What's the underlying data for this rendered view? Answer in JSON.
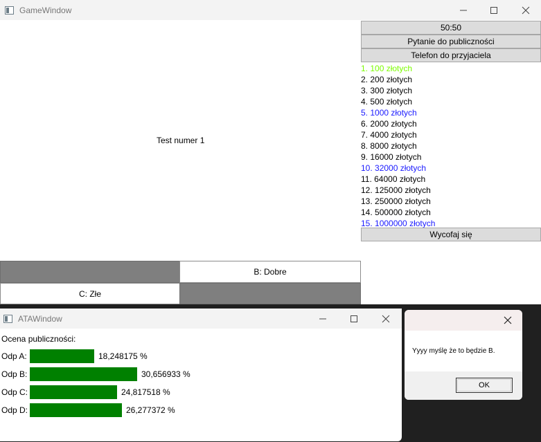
{
  "game_window": {
    "title": "GameWindow",
    "question": "Test numer 1",
    "lifelines": {
      "fifty": "50:50",
      "audience": "Pytanie do publiczności",
      "phone": "Telefon do przyjaciela"
    },
    "prizes": [
      {
        "label": "1. 100 złotych",
        "color": "#7cfc00"
      },
      {
        "label": "2. 200 złotych",
        "color": "#000000"
      },
      {
        "label": "3. 300 złotych",
        "color": "#000000"
      },
      {
        "label": "4. 500 złotych",
        "color": "#000000"
      },
      {
        "label": "5. 1000 złotych",
        "color": "#1a1aff"
      },
      {
        "label": "6. 2000 złotych",
        "color": "#000000"
      },
      {
        "label": "7. 4000 złotych",
        "color": "#000000"
      },
      {
        "label": "8. 8000 złotych",
        "color": "#000000"
      },
      {
        "label": "9. 16000 złotych",
        "color": "#000000"
      },
      {
        "label": "10. 32000 złotych",
        "color": "#1a1aff"
      },
      {
        "label": "11. 64000 złotych",
        "color": "#000000"
      },
      {
        "label": "12. 125000 złotych",
        "color": "#000000"
      },
      {
        "label": "13. 250000 złotych",
        "color": "#000000"
      },
      {
        "label": "14. 500000 złotych",
        "color": "#000000"
      },
      {
        "label": "15. 1000000 złotych",
        "color": "#1a1aff"
      }
    ],
    "withdraw": "Wycofaj się",
    "answers": {
      "a": "",
      "b": "B: Dobre",
      "c": "C: Złe",
      "d": ""
    }
  },
  "ata_window": {
    "title": "ATAWindow",
    "heading": "Ocena publiczności:",
    "rows": [
      {
        "label": "Odp A:",
        "percent_text": "18,248175 %",
        "value": 18.248175
      },
      {
        "label": "Odp B:",
        "percent_text": "30,656933 %",
        "value": 30.656933
      },
      {
        "label": "Odp C:",
        "percent_text": "24,817518 %",
        "value": 24.817518
      },
      {
        "label": "Odp D:",
        "percent_text": "26,277372 %",
        "value": 26.277372
      }
    ],
    "bar_color": "#008000"
  },
  "message_box": {
    "text": "Yyyy myślę że to będzie B.",
    "ok_label": "OK"
  }
}
